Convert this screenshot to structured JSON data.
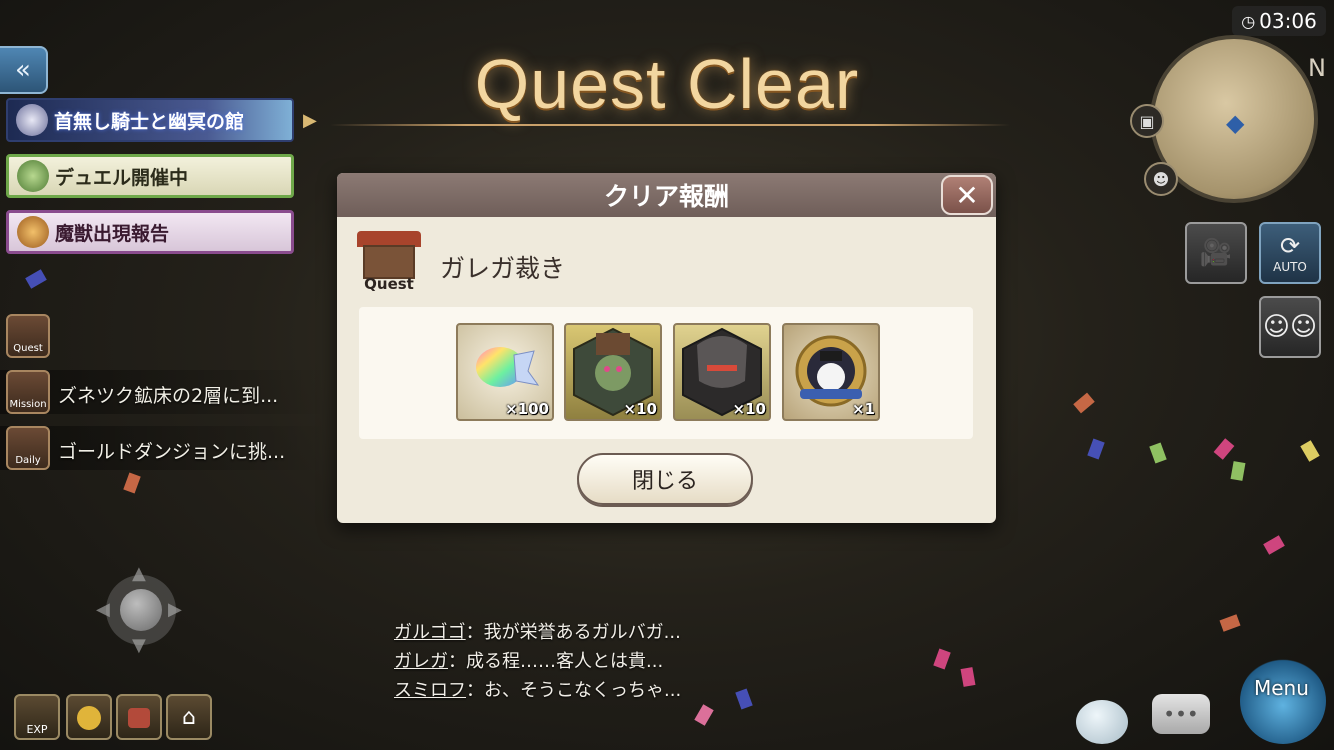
{
  "title": "Quest Clear",
  "clock": "03:06",
  "map": {
    "compass": "N"
  },
  "left": {
    "back_glyph": "«",
    "banners": [
      {
        "label": "首無し騎士と幽冥の館"
      },
      {
        "label": "デュエル開催中"
      },
      {
        "label": "魔獣出現報告"
      }
    ],
    "tasks": [
      {
        "icon_label": "Quest",
        "text": ""
      },
      {
        "icon_label": "Mission",
        "text": "ズネツク鉱床の2層に到..."
      },
      {
        "icon_label": "Daily",
        "text": "ゴールドダンジョンに挑..."
      }
    ]
  },
  "dialog": {
    "header": "クリア報酬",
    "close_glyph": "✕",
    "quest_icon_label": "Quest",
    "quest_name": "ガレガ裁き",
    "rewards": [
      {
        "icon": "rainbow-gem-icon",
        "qty": "×100"
      },
      {
        "icon": "orc-warrior-portrait-icon",
        "qty": "×10"
      },
      {
        "icon": "dark-knight-portrait-icon",
        "qty": "×10"
      },
      {
        "icon": "snowman-emblem-icon",
        "qty": "×1"
      }
    ],
    "close_button": "閉じる"
  },
  "log": [
    {
      "speaker": "ガルゴゴ",
      "text": "：我が栄誉あるガルバガ..."
    },
    {
      "speaker": "ガレガ",
      "text": "：成る程……客人とは貴..."
    },
    {
      "speaker": "スミロフ",
      "text": "：お、そうこなくっちゃ..."
    }
  ],
  "bottom_left": [
    {
      "label": "EXP"
    },
    {
      "label": ""
    },
    {
      "label": ""
    },
    {
      "label": ""
    }
  ],
  "right": {
    "auto_label": "AUTO",
    "menu_label": "Menu"
  },
  "colors": {
    "accent_gold": "#f2d6a0",
    "dialog_bg": "#efeadc",
    "header": "#7d6b66"
  }
}
